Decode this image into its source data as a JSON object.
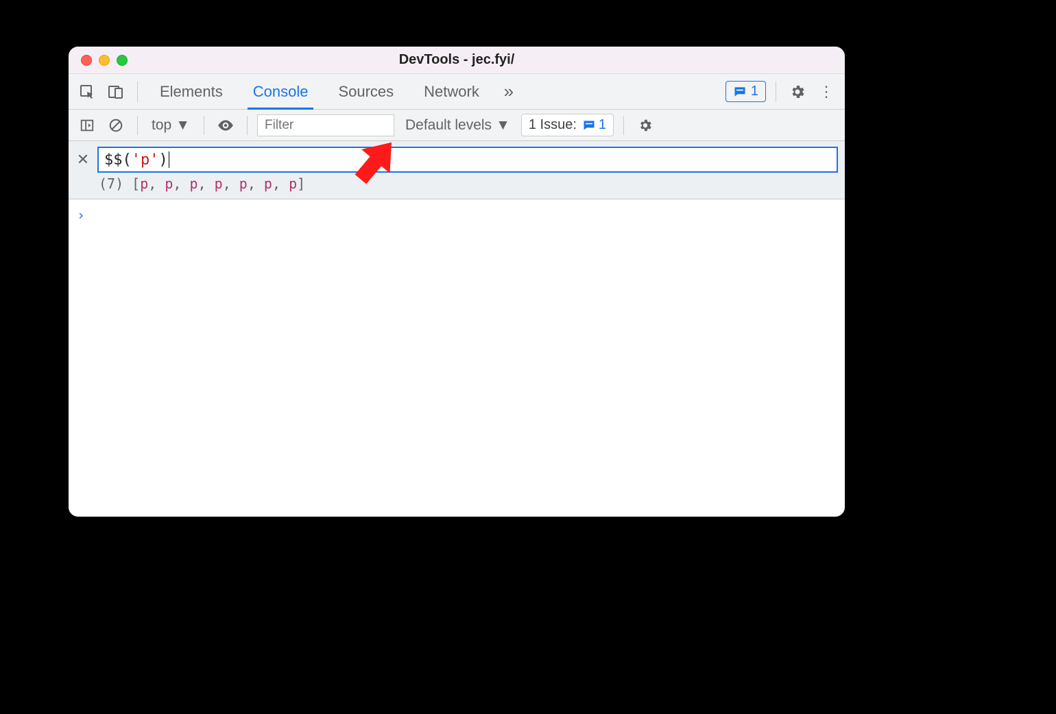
{
  "window": {
    "title": "DevTools - jec.fyi/"
  },
  "tabs": {
    "elements": "Elements",
    "console": "Console",
    "sources": "Sources",
    "network": "Network",
    "feedback_count": "1"
  },
  "consoleToolbar": {
    "context": "top",
    "filter_placeholder": "Filter",
    "levels": "Default levels",
    "issues_label": "1 Issue:",
    "issues_count": "1"
  },
  "eager": {
    "expr_fn": "$$",
    "expr_open": "(",
    "expr_str": "'p'",
    "expr_close": ")",
    "result_count": "(7)",
    "result_open": "[",
    "result_items": [
      "p",
      "p",
      "p",
      "p",
      "p",
      "p",
      "p"
    ],
    "result_close": "]"
  }
}
